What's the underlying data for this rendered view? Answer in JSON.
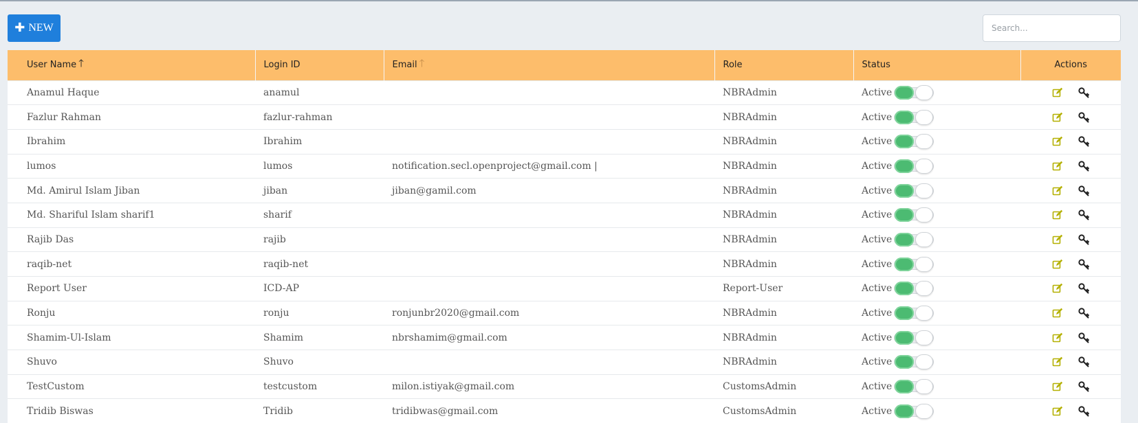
{
  "toolbar": {
    "new_label": "NEW",
    "search_placeholder": "Search..."
  },
  "table": {
    "columns": [
      {
        "label": "User Name",
        "sort": "asc-active"
      },
      {
        "label": "Login ID",
        "sort": "none"
      },
      {
        "label": "Email",
        "sort": "asc-inactive"
      },
      {
        "label": "Role",
        "sort": "none"
      },
      {
        "label": "Status",
        "sort": "none"
      },
      {
        "label": "Actions",
        "sort": "none"
      }
    ],
    "rows": [
      {
        "name": "Anamul Haque",
        "login": "anamul",
        "email": "",
        "role": "NBRAdmin",
        "status": "Active"
      },
      {
        "name": "Fazlur Rahman",
        "login": "fazlur-rahman",
        "email": "",
        "role": "NBRAdmin",
        "status": "Active"
      },
      {
        "name": "Ibrahim",
        "login": "Ibrahim",
        "email": "",
        "role": "NBRAdmin",
        "status": "Active"
      },
      {
        "name": "lumos",
        "login": "lumos",
        "email": "notification.secl.openproject@gmail.com |",
        "role": "NBRAdmin",
        "status": "Active"
      },
      {
        "name": "Md. Amirul Islam Jiban",
        "login": "jiban",
        "email": "jiban@gamil.com",
        "role": "NBRAdmin",
        "status": "Active"
      },
      {
        "name": "Md. Shariful Islam sharif1",
        "login": "sharif",
        "email": "",
        "role": "NBRAdmin",
        "status": "Active"
      },
      {
        "name": "Rajib Das",
        "login": "rajib",
        "email": "",
        "role": "NBRAdmin",
        "status": "Active"
      },
      {
        "name": "raqib-net",
        "login": "raqib-net",
        "email": "",
        "role": "NBRAdmin",
        "status": "Active"
      },
      {
        "name": "Report User",
        "login": "ICD-AP",
        "email": "",
        "role": "Report-User",
        "status": "Active"
      },
      {
        "name": "Ronju",
        "login": "ronju",
        "email": "ronjunbr2020@gmail.com",
        "role": "NBRAdmin",
        "status": "Active"
      },
      {
        "name": "Shamim-Ul-Islam",
        "login": "Shamim",
        "email": "nbrshamim@gmail.com",
        "role": "NBRAdmin",
        "status": "Active"
      },
      {
        "name": "Shuvo",
        "login": "Shuvo",
        "email": "",
        "role": "NBRAdmin",
        "status": "Active"
      },
      {
        "name": "TestCustom",
        "login": "testcustom",
        "email": "milon.istiyak@gmail.com",
        "role": "CustomsAdmin",
        "status": "Active"
      },
      {
        "name": "Tridib Biswas",
        "login": "Tridib",
        "email": "tridibwas@gmail.com",
        "role": "CustomsAdmin",
        "status": "Active"
      }
    ]
  },
  "icons": {
    "new": "plus-icon",
    "sort_active": "arrow-up-icon",
    "sort_inactive": "arrow-up-icon",
    "edit": "edit-icon",
    "permissions": "key-icon"
  },
  "colors": {
    "primary": "#1f7fdc",
    "header": "#fdbd6b",
    "toggle_on": "#4cbb72",
    "edit_icon": "#b4b000"
  }
}
